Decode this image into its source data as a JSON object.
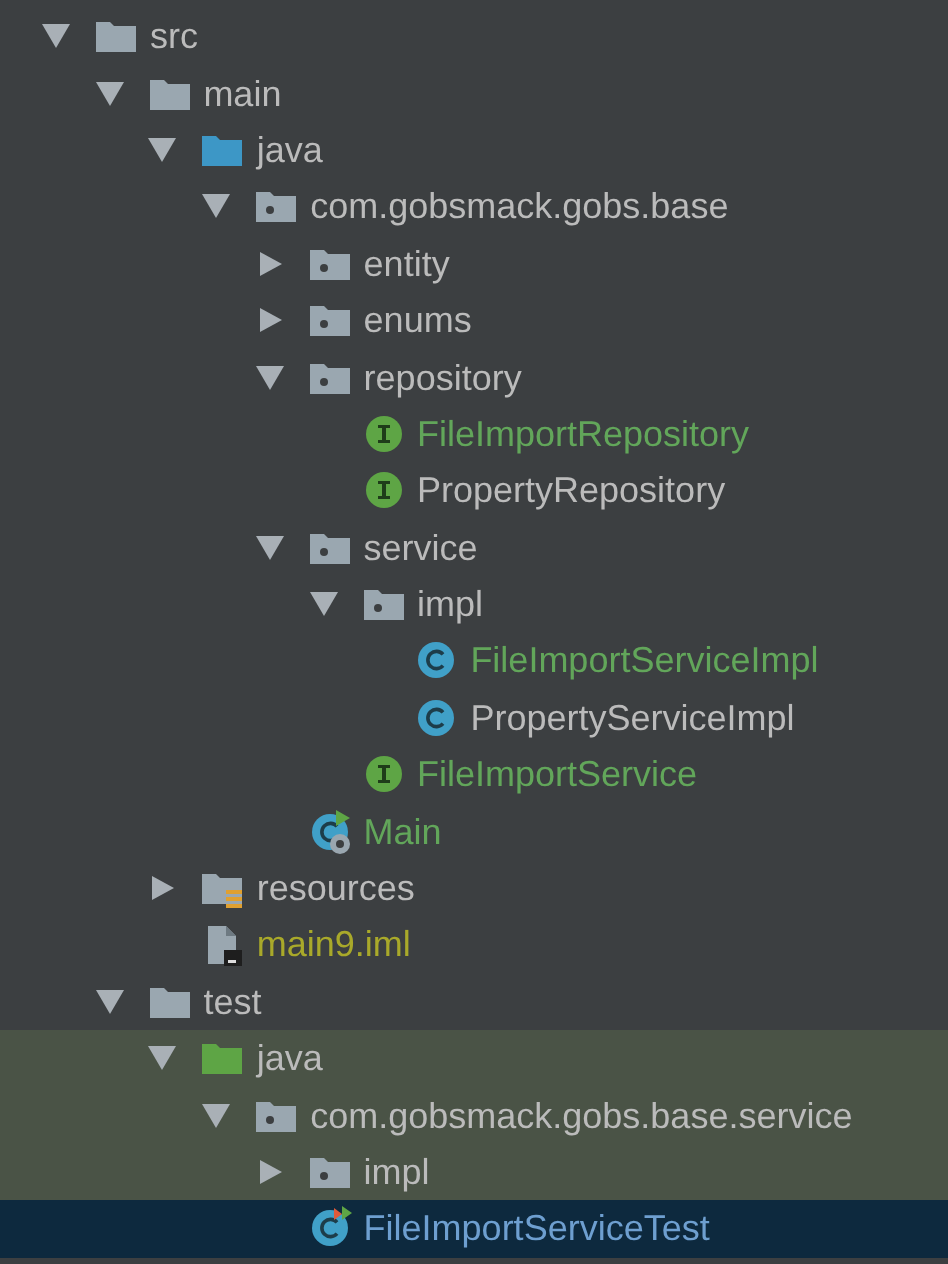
{
  "tree": [
    {
      "label": "src",
      "kind": "folder",
      "expanded": true,
      "selected": false,
      "scoped": false,
      "color": "#bbbbbb",
      "children": [
        {
          "label": "main",
          "kind": "folder",
          "expanded": true,
          "selected": false,
          "scoped": false,
          "color": "#bbbbbb",
          "children": [
            {
              "label": "java",
              "kind": "source-folder",
              "expanded": true,
              "selected": false,
              "scoped": false,
              "color": "#bbbbbb",
              "children": [
                {
                  "label": "com.gobsmack.gobs.base",
                  "kind": "package",
                  "expanded": true,
                  "selected": false,
                  "scoped": false,
                  "color": "#bbbbbb",
                  "children": [
                    {
                      "label": "entity",
                      "kind": "package",
                      "expanded": false,
                      "selected": false,
                      "scoped": false,
                      "color": "#bbbbbb"
                    },
                    {
                      "label": "enums",
                      "kind": "package",
                      "expanded": false,
                      "selected": false,
                      "scoped": false,
                      "color": "#bbbbbb"
                    },
                    {
                      "label": "repository",
                      "kind": "package",
                      "expanded": true,
                      "selected": false,
                      "scoped": false,
                      "color": "#bbbbbb",
                      "children": [
                        {
                          "label": "FileImportRepository",
                          "kind": "interface",
                          "selected": false,
                          "scoped": false,
                          "color": "#62a65a"
                        },
                        {
                          "label": "PropertyRepository",
                          "kind": "interface",
                          "selected": false,
                          "scoped": false,
                          "color": "#bbbbbb"
                        }
                      ]
                    },
                    {
                      "label": "service",
                      "kind": "package",
                      "expanded": true,
                      "selected": false,
                      "scoped": false,
                      "color": "#bbbbbb",
                      "children": [
                        {
                          "label": "impl",
                          "kind": "package",
                          "expanded": true,
                          "selected": false,
                          "scoped": false,
                          "color": "#bbbbbb",
                          "children": [
                            {
                              "label": "FileImportServiceImpl",
                              "kind": "class",
                              "selected": false,
                              "scoped": false,
                              "color": "#62a65a"
                            },
                            {
                              "label": "PropertyServiceImpl",
                              "kind": "class",
                              "selected": false,
                              "scoped": false,
                              "color": "#bbbbbb"
                            }
                          ]
                        },
                        {
                          "label": "FileImportService",
                          "kind": "interface",
                          "selected": false,
                          "scoped": false,
                          "color": "#62a65a"
                        }
                      ]
                    },
                    {
                      "label": "Main",
                      "kind": "main-class",
                      "selected": false,
                      "scoped": false,
                      "color": "#62a65a"
                    }
                  ]
                }
              ]
            },
            {
              "label": "resources",
              "kind": "resources",
              "expanded": false,
              "selected": false,
              "scoped": false,
              "color": "#bbbbbb"
            },
            {
              "label": "main9.iml",
              "kind": "iml",
              "selected": false,
              "scoped": false,
              "color": "#a9a92a"
            }
          ]
        },
        {
          "label": "test",
          "kind": "folder",
          "expanded": true,
          "selected": false,
          "scoped": false,
          "color": "#bbbbbb",
          "children": [
            {
              "label": "java",
              "kind": "test-folder",
              "expanded": true,
              "selected": false,
              "scoped": true,
              "color": "#bbbbbb",
              "children": [
                {
                  "label": "com.gobsmack.gobs.base.service",
                  "kind": "package",
                  "expanded": true,
                  "selected": false,
                  "scoped": true,
                  "color": "#bbbbbb",
                  "children": [
                    {
                      "label": "impl",
                      "kind": "package",
                      "expanded": false,
                      "selected": false,
                      "scoped": true,
                      "color": "#bbbbbb"
                    },
                    {
                      "label": "FileImportServiceTest",
                      "kind": "test-class",
                      "selected": true,
                      "scoped": true,
                      "color": "#6e9fd0"
                    }
                  ]
                }
              ]
            }
          ]
        }
      ]
    }
  ]
}
